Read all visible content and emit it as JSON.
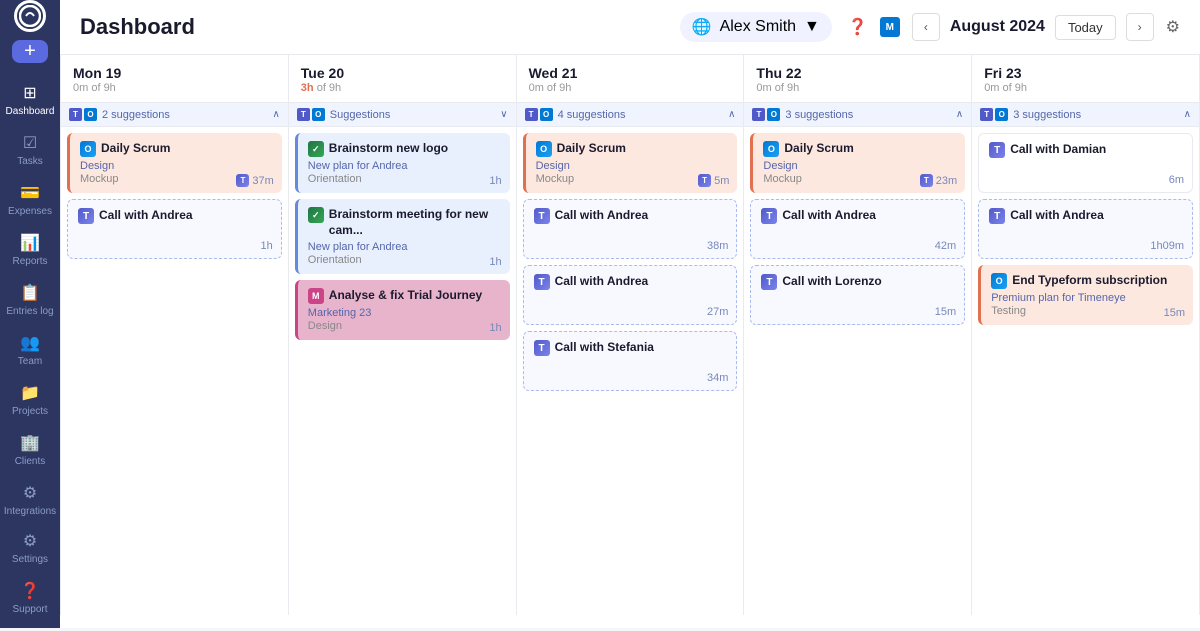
{
  "sidebar": {
    "logo": "T",
    "add_label": "+",
    "items": [
      {
        "id": "dashboard",
        "label": "Dashboard",
        "icon": "⊞",
        "active": true
      },
      {
        "id": "tasks",
        "label": "Tasks",
        "icon": "☑"
      },
      {
        "id": "expenses",
        "label": "Expenses",
        "icon": "💳"
      },
      {
        "id": "reports",
        "label": "Reports",
        "icon": "📊"
      },
      {
        "id": "entries-log",
        "label": "Entries log",
        "icon": "📋"
      },
      {
        "id": "team",
        "label": "Team",
        "icon": "👥"
      },
      {
        "id": "projects",
        "label": "Projects",
        "icon": "📁"
      },
      {
        "id": "clients",
        "label": "Clients",
        "icon": "🏢"
      },
      {
        "id": "integrations",
        "label": "Integrations",
        "icon": "⚙"
      },
      {
        "id": "settings",
        "label": "Settings",
        "icon": "⚙"
      },
      {
        "id": "support",
        "label": "Support",
        "icon": "❓"
      }
    ]
  },
  "header": {
    "title": "Dashboard",
    "user_name": "Alex Smith",
    "user_globe": "🌐",
    "month_label": "August 2024",
    "today_btn": "Today"
  },
  "days": [
    {
      "name": "Mon 19",
      "time_used": "0m",
      "time_total": "9h",
      "suggestions": {
        "count": "2 suggestions",
        "open": true
      },
      "events": [
        {
          "type": "salmon",
          "icon": "outlook",
          "title": "Daily Scrum",
          "subtitle": "Design",
          "sub2": "Mockup",
          "time": "37m",
          "has_teams": true
        },
        {
          "type": "dashed",
          "icon": "teams",
          "title": "Call with Andrea",
          "subtitle": "",
          "sub2": "",
          "time": "1h",
          "has_teams": false
        }
      ]
    },
    {
      "name": "Tue 20",
      "time_used": "3h",
      "time_total": "9h",
      "suggestions": {
        "count": "Suggestions",
        "open": false
      },
      "events": [
        {
          "type": "blue-light",
          "icon": "check",
          "title": "Brainstorm new logo",
          "subtitle": "New plan for Andrea",
          "sub2": "Orientation",
          "time": "1h",
          "has_teams": false
        },
        {
          "type": "blue-light",
          "icon": "check",
          "title": "Brainstorm meeting for new cam...",
          "subtitle": "New plan for Andrea",
          "sub2": "Orientation",
          "time": "1h",
          "has_teams": false
        },
        {
          "type": "pink",
          "icon": "ms",
          "title": "Analyse & fix Trial Journey",
          "subtitle": "Marketing 23",
          "sub2": "Design",
          "time": "1h",
          "has_teams": false
        }
      ]
    },
    {
      "name": "Wed 21",
      "time_used": "0m",
      "time_total": "9h",
      "suggestions": {
        "count": "4 suggestions",
        "open": true
      },
      "events": [
        {
          "type": "salmon",
          "icon": "outlook",
          "title": "Daily Scrum",
          "subtitle": "Design",
          "sub2": "Mockup",
          "time": "5m",
          "has_teams": true
        },
        {
          "type": "dashed",
          "icon": "teams",
          "title": "Call with Andrea",
          "subtitle": "",
          "sub2": "",
          "time": "38m",
          "has_teams": false
        },
        {
          "type": "dashed",
          "icon": "teams",
          "title": "Call with Andrea",
          "subtitle": "",
          "sub2": "",
          "time": "27m",
          "has_teams": false
        },
        {
          "type": "dashed",
          "icon": "teams",
          "title": "Call with Stefania",
          "subtitle": "",
          "sub2": "",
          "time": "34m",
          "has_teams": false
        }
      ]
    },
    {
      "name": "Thu 22",
      "time_used": "0m",
      "time_total": "9h",
      "suggestions": {
        "count": "3 suggestions",
        "open": true
      },
      "events": [
        {
          "type": "salmon",
          "icon": "outlook",
          "title": "Daily Scrum",
          "subtitle": "Design",
          "sub2": "Mockup",
          "time": "23m",
          "has_teams": true
        },
        {
          "type": "dashed",
          "icon": "teams",
          "title": "Call with Andrea",
          "subtitle": "",
          "sub2": "",
          "time": "42m",
          "has_teams": false
        },
        {
          "type": "dashed",
          "icon": "teams",
          "title": "Call with Lorenzo",
          "subtitle": "",
          "sub2": "",
          "time": "15m",
          "has_teams": false
        }
      ]
    },
    {
      "name": "Fri 23",
      "time_used": "0m",
      "time_total": "9h",
      "suggestions": {
        "count": "3 suggestions",
        "open": true
      },
      "events": [
        {
          "type": "white",
          "icon": "teams",
          "title": "Call with Damian",
          "subtitle": "",
          "sub2": "",
          "time": "6m",
          "has_teams": false
        },
        {
          "type": "dashed",
          "icon": "teams",
          "title": "Call with Andrea",
          "subtitle": "",
          "sub2": "",
          "time": "1h09m",
          "has_teams": false
        },
        {
          "type": "salmon",
          "icon": "outlook",
          "title": "End Typeform subscription",
          "subtitle": "Premium plan for Timeneye",
          "sub2": "Testing",
          "time": "15m",
          "has_teams": false
        }
      ]
    }
  ]
}
